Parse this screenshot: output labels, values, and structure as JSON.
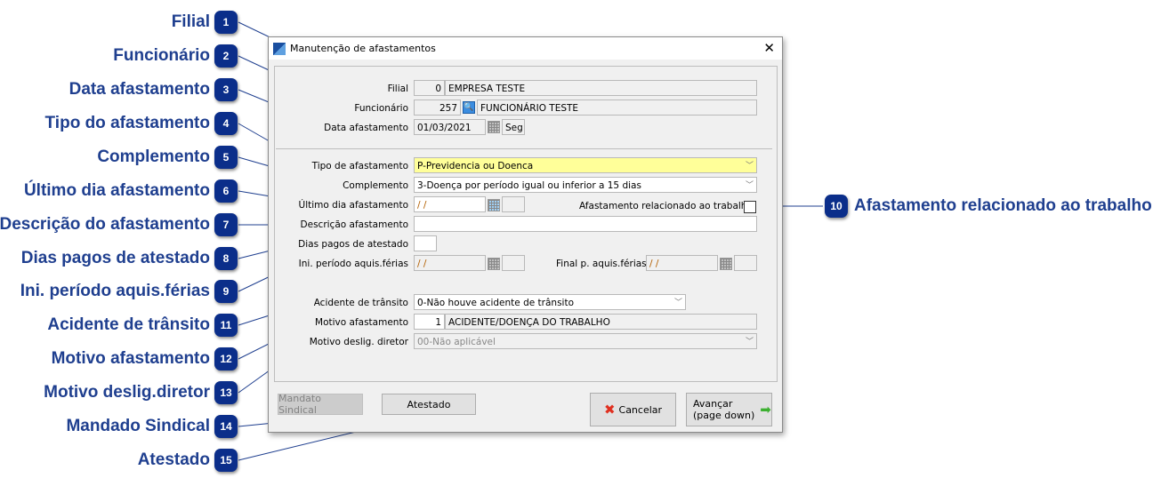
{
  "callouts": [
    {
      "n": "1",
      "label": "Filial"
    },
    {
      "n": "2",
      "label": "Funcionário"
    },
    {
      "n": "3",
      "label": "Data afastamento"
    },
    {
      "n": "4",
      "label": "Tipo do afastamento"
    },
    {
      "n": "5",
      "label": "Complemento"
    },
    {
      "n": "6",
      "label": "Último dia afastamento"
    },
    {
      "n": "7",
      "label": "Descrição do afastamento"
    },
    {
      "n": "8",
      "label": "Dias pagos de atestado"
    },
    {
      "n": "9",
      "label": "Ini. período aquis.férias"
    },
    {
      "n": "10",
      "label": "Afastamento relacionado ao trabalho"
    },
    {
      "n": "11",
      "label": "Acidente de trânsito"
    },
    {
      "n": "12",
      "label": "Motivo afastamento"
    },
    {
      "n": "13",
      "label": "Motivo deslig.diretor"
    },
    {
      "n": "14",
      "label": "Mandado Sindical"
    },
    {
      "n": "15",
      "label": "Atestado"
    }
  ],
  "dialog": {
    "title": "Manutenção de afastamentos",
    "close": "✕",
    "filial": {
      "label": "Filial",
      "code": "0",
      "name": "EMPRESA TESTE"
    },
    "funcionario": {
      "label": "Funcionário",
      "code": "257",
      "name": "FUNCIONÁRIO TESTE"
    },
    "data_afastamento": {
      "label": "Data afastamento",
      "value": "01/03/2021",
      "weekday": "Seg"
    },
    "tipo": {
      "label": "Tipo de afastamento",
      "value": "P-Previdencia ou Doenca"
    },
    "complemento": {
      "label": "Complemento",
      "value": "3-Doença por período igual ou inferior a 15 dias"
    },
    "ultimo_dia": {
      "label": "Último dia afastamento",
      "value": " /  /"
    },
    "relacionado": {
      "label": "Afastamento relacionado ao trabalho",
      "checked": false
    },
    "descricao": {
      "label": "Descrição afastamento",
      "value": ""
    },
    "dias_pagos": {
      "label": "Dias pagos de atestado",
      "value": ""
    },
    "ini_periodo": {
      "label": "Ini. período aquis.férias",
      "value": " /  /"
    },
    "final_periodo": {
      "label": "Final p. aquis.férias",
      "value": " /  /"
    },
    "acidente": {
      "label": "Acidente de trânsito",
      "value": "0-Não houve acidente de trânsito"
    },
    "motivo": {
      "label": "Motivo afastamento",
      "code": "1",
      "name": "ACIDENTE/DOENÇA DO TRABALHO"
    },
    "motivo_deslig": {
      "label": "Motivo deslig. diretor",
      "value": "00-Não aplicável"
    },
    "buttons": {
      "mandato": "Mandato Sindical",
      "atestado": "Atestado",
      "cancelar": "Cancelar",
      "avancar": "Avançar",
      "avancar_sub": "(page down)"
    }
  }
}
